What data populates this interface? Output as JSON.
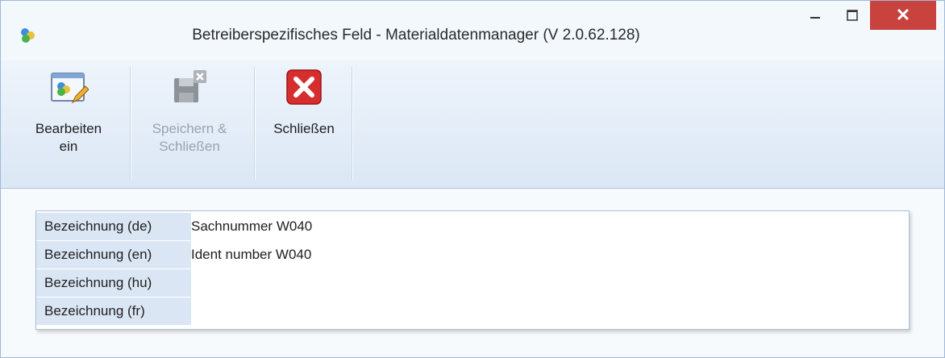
{
  "window": {
    "title": "Betreiberspezifisches Feld - Materialdatenmanager (V 2.0.62.128)",
    "close_glyph": "✕",
    "accent": "#c8423e"
  },
  "ribbon": {
    "buttons": [
      {
        "label": "Bearbeiten\nein",
        "icon": "edit-icon",
        "enabled": true
      },
      {
        "label": "Speichern &\nSchließen",
        "icon": "save-close-icon",
        "enabled": false
      },
      {
        "label": "Schließen",
        "icon": "close-red-icon",
        "enabled": true
      }
    ]
  },
  "fields": [
    {
      "label": "Bezeichnung (de)",
      "value": "Sachnummer W040"
    },
    {
      "label": "Bezeichnung (en)",
      "value": "Ident number W040"
    },
    {
      "label": "Bezeichnung (hu)",
      "value": ""
    },
    {
      "label": "Bezeichnung (fr)",
      "value": ""
    }
  ]
}
